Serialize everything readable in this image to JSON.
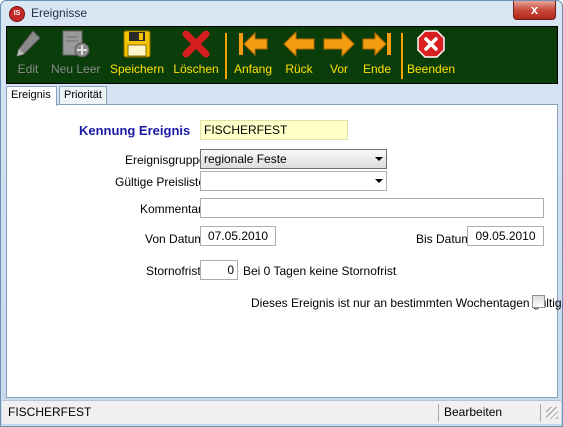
{
  "window": {
    "title": "Ereignisse",
    "close_label": "x",
    "app_icon_text": "IS"
  },
  "toolbar": {
    "edit": "Edit",
    "new_empty": "Neu Leer",
    "save": "Speichern",
    "delete": "Löschen",
    "first": "Anfang",
    "back": "Rück",
    "forward": "Vor",
    "last": "Ende",
    "quit": "Beenden"
  },
  "tabs": [
    {
      "label": "Ereignis",
      "active": true
    },
    {
      "label": "Priorität",
      "active": false
    }
  ],
  "form": {
    "id_label": "Kennung  Ereignis",
    "id_value": "FISCHERFEST",
    "group_label": "Ereignisgruppe",
    "group_value": "regionale Feste",
    "pricelist_label": "Gültige Preisliste",
    "pricelist_value": "",
    "comment_label": "Kommentar",
    "comment_value": "",
    "from_label": "Von Datum",
    "from_value": "07.05.2010",
    "to_label": "Bis Datum",
    "to_value": "09.05.2010",
    "cancel_label": "Stornofrist",
    "cancel_value": "0",
    "cancel_note": "Bei 0 Tagen keine Stornofrist",
    "weekday_label": "Dieses Ereignis ist nur an bestimmten Wochentagen gültig.",
    "weekday_checked": false
  },
  "status": {
    "left": "FISCHERFEST",
    "mode": "Bearbeiten"
  },
  "colors": {
    "toolbar_bg": "#0a3d0a",
    "toolbar_label": "#ffe000",
    "arrow_orange": "#f39c12",
    "id_label_blue": "#1a1aa6",
    "id_field_bg": "#ffffc8"
  }
}
